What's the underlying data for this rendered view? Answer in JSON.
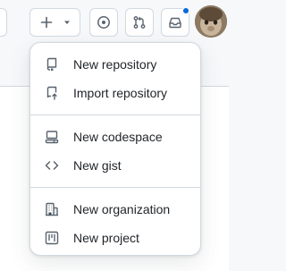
{
  "header": {
    "create_button_icon": "plus-icon",
    "create_dropdown_icon": "triangle-down-icon",
    "copilot_icon": "copilot-icon",
    "pull_requests_icon": "git-pull-request-icon",
    "inbox_icon": "inbox-icon",
    "notification_dot_color": "#0969da"
  },
  "menu": {
    "groups": [
      {
        "items": [
          {
            "label": "New repository",
            "icon": "repo-icon"
          },
          {
            "label": "Import repository",
            "icon": "repo-push-icon"
          }
        ]
      },
      {
        "items": [
          {
            "label": "New codespace",
            "icon": "codespaces-icon"
          },
          {
            "label": "New gist",
            "icon": "code-icon"
          }
        ]
      },
      {
        "items": [
          {
            "label": "New organization",
            "icon": "organization-icon"
          },
          {
            "label": "New project",
            "icon": "project-icon"
          }
        ]
      }
    ]
  }
}
